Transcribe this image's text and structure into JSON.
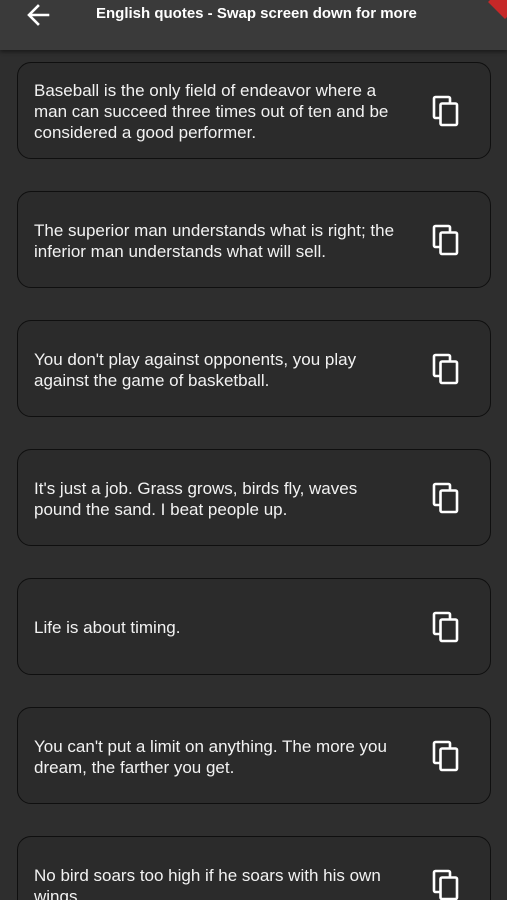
{
  "app_bar": {
    "title": "English quotes - Swap screen down for more",
    "back_icon": "arrow-left-icon"
  },
  "colors": {
    "background": "#2e2e2e",
    "app_bar": "#3a3a3a",
    "card_border": "#0f0f0f",
    "text": "#f2f2f2",
    "accent_badge": "#c62828"
  },
  "quotes": [
    {
      "text": "Baseball is the only field of endeavor where a man can succeed three times out of ten and be considered a good performer.",
      "icon": "copy-icon"
    },
    {
      "text": "The superior man understands what is right; the inferior man understands what will sell.",
      "icon": "copy-icon"
    },
    {
      "text": "You don't play against opponents, you play against the game of basketball.",
      "icon": "copy-icon"
    },
    {
      "text": "It's just a job. Grass grows, birds fly, waves pound the sand. I beat people up.",
      "icon": "copy-icon"
    },
    {
      "text": "Life is about timing.",
      "icon": "copy-icon"
    },
    {
      "text": "You can't put a limit on anything. The more you dream, the farther you get.",
      "icon": "copy-icon"
    },
    {
      "text": "No bird soars too high if he soars with his own wings.",
      "icon": "copy-icon"
    }
  ]
}
